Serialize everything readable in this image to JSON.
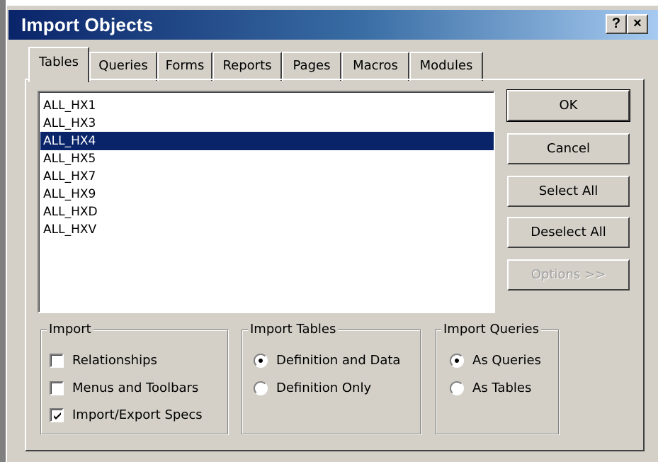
{
  "window": {
    "title": "Import Objects",
    "help_button": "?",
    "close_button": "×"
  },
  "tabs": [
    {
      "label": "Tables",
      "active": true
    },
    {
      "label": "Queries",
      "active": false
    },
    {
      "label": "Forms",
      "active": false
    },
    {
      "label": "Reports",
      "active": false
    },
    {
      "label": "Pages",
      "active": false
    },
    {
      "label": "Macros",
      "active": false
    },
    {
      "label": "Modules",
      "active": false
    }
  ],
  "object_list": {
    "items": [
      "ALL_HX1",
      "ALL_HX3",
      "ALL_HX4",
      "ALL_HX5",
      "ALL_HX7",
      "ALL_HX9",
      "ALL_HXD",
      "ALL_HXV"
    ],
    "selected": "ALL_HX4"
  },
  "buttons": {
    "ok": "OK",
    "cancel": "Cancel",
    "select_all": "Select All",
    "deselect_all": "Deselect All",
    "options": "Options >>"
  },
  "import_group": {
    "label": "Import",
    "options": [
      {
        "label": "Relationships",
        "checked": false
      },
      {
        "label": "Menus and Toolbars",
        "checked": false
      },
      {
        "label": "Import/Export Specs",
        "checked": true
      }
    ]
  },
  "import_tables_group": {
    "label": "Import Tables",
    "options": [
      {
        "label": "Definition and Data",
        "selected": true
      },
      {
        "label": "Definition Only",
        "selected": false
      }
    ]
  },
  "import_queries_group": {
    "label": "Import Queries",
    "options": [
      {
        "label": "As Queries",
        "selected": true
      },
      {
        "label": "As Tables",
        "selected": false
      }
    ]
  },
  "colors": {
    "dialog_face": "#d4d0c8",
    "titlebar_start": "#0a246a",
    "titlebar_end": "#a6caf0",
    "selection": "#0a246a"
  }
}
